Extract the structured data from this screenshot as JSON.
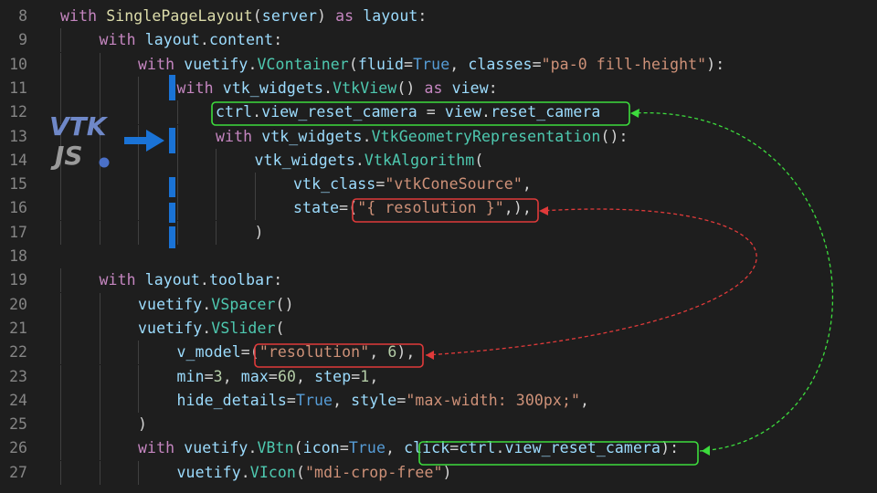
{
  "colors": {
    "background": "#1e1e1e",
    "line_number": "#858585",
    "keyword": "#c586c0",
    "function": "#dcdcaa",
    "class": "#4ec9b0",
    "variable": "#9cdcfe",
    "string": "#ce9178",
    "number": "#b5cea8",
    "builtin": "#569cd6",
    "highlight_green": "#3ddc3d",
    "highlight_red": "#e03a3a",
    "arrow_blue": "#1a73d6"
  },
  "logo": {
    "top_text": "VTK",
    "bottom_text": "JS",
    "icon": "vtkjs-logo-icon"
  },
  "arrow_icon": "right-arrow-icon",
  "lines": [
    {
      "n": "8",
      "indent": 0,
      "tokens": [
        [
          "kw",
          "with"
        ],
        [
          "op",
          " "
        ],
        [
          "fn",
          "SinglePageLayout"
        ],
        [
          "op",
          "("
        ],
        [
          "var",
          "server"
        ],
        [
          "op",
          ") "
        ],
        [
          "kw",
          "as"
        ],
        [
          "op",
          " "
        ],
        [
          "var",
          "layout"
        ],
        [
          "op",
          ":"
        ]
      ]
    },
    {
      "n": "9",
      "indent": 1,
      "tokens": [
        [
          "kw",
          "with"
        ],
        [
          "op",
          " "
        ],
        [
          "var",
          "layout"
        ],
        [
          "op",
          "."
        ],
        [
          "var",
          "content"
        ],
        [
          "op",
          ":"
        ]
      ]
    },
    {
      "n": "10",
      "indent": 2,
      "tokens": [
        [
          "kw",
          "with"
        ],
        [
          "op",
          " "
        ],
        [
          "var",
          "vuetify"
        ],
        [
          "op",
          "."
        ],
        [
          "cls",
          "VContainer"
        ],
        [
          "op",
          "("
        ],
        [
          "var",
          "fluid"
        ],
        [
          "op",
          "="
        ],
        [
          "bi",
          "True"
        ],
        [
          "op",
          ", "
        ],
        [
          "var",
          "classes"
        ],
        [
          "op",
          "="
        ],
        [
          "str",
          "\"pa-0 fill-height\""
        ],
        [
          "op",
          "):"
        ]
      ]
    },
    {
      "n": "11",
      "indent": 3,
      "tokens": [
        [
          "kw",
          "with"
        ],
        [
          "op",
          " "
        ],
        [
          "var",
          "vtk_widgets"
        ],
        [
          "op",
          "."
        ],
        [
          "cls",
          "VtkView"
        ],
        [
          "op",
          "() "
        ],
        [
          "kw",
          "as"
        ],
        [
          "op",
          " "
        ],
        [
          "var",
          "view"
        ],
        [
          "op",
          ":"
        ]
      ]
    },
    {
      "n": "12",
      "indent": 4,
      "tokens": [
        [
          "var",
          "ctrl"
        ],
        [
          "op",
          "."
        ],
        [
          "var",
          "view_reset_camera"
        ],
        [
          "op",
          " = "
        ],
        [
          "var",
          "view"
        ],
        [
          "op",
          "."
        ],
        [
          "var",
          "reset_camera"
        ]
      ]
    },
    {
      "n": "13",
      "indent": 4,
      "tokens": [
        [
          "kw",
          "with"
        ],
        [
          "op",
          " "
        ],
        [
          "var",
          "vtk_widgets"
        ],
        [
          "op",
          "."
        ],
        [
          "cls",
          "VtkGeometryRepresentation"
        ],
        [
          "op",
          "():"
        ]
      ]
    },
    {
      "n": "14",
      "indent": 5,
      "tokens": [
        [
          "var",
          "vtk_widgets"
        ],
        [
          "op",
          "."
        ],
        [
          "cls",
          "VtkAlgorithm"
        ],
        [
          "op",
          "("
        ]
      ]
    },
    {
      "n": "15",
      "indent": 6,
      "tokens": [
        [
          "var",
          "vtk_class"
        ],
        [
          "op",
          "="
        ],
        [
          "str",
          "\"vtkConeSource\""
        ],
        [
          "op",
          ","
        ]
      ]
    },
    {
      "n": "16",
      "indent": 6,
      "tokens": [
        [
          "var",
          "state"
        ],
        [
          "op",
          "=("
        ],
        [
          "str",
          "\"{ resolution }\""
        ],
        [
          "op",
          ",),"
        ]
      ]
    },
    {
      "n": "17",
      "indent": 5,
      "tokens": [
        [
          "op",
          ")"
        ]
      ]
    },
    {
      "n": "18",
      "indent": 0,
      "tokens": []
    },
    {
      "n": "19",
      "indent": 1,
      "tokens": [
        [
          "kw",
          "with"
        ],
        [
          "op",
          " "
        ],
        [
          "var",
          "layout"
        ],
        [
          "op",
          "."
        ],
        [
          "var",
          "toolbar"
        ],
        [
          "op",
          ":"
        ]
      ]
    },
    {
      "n": "20",
      "indent": 2,
      "tokens": [
        [
          "var",
          "vuetify"
        ],
        [
          "op",
          "."
        ],
        [
          "cls",
          "VSpacer"
        ],
        [
          "op",
          "()"
        ]
      ]
    },
    {
      "n": "21",
      "indent": 2,
      "tokens": [
        [
          "var",
          "vuetify"
        ],
        [
          "op",
          "."
        ],
        [
          "cls",
          "VSlider"
        ],
        [
          "op",
          "("
        ]
      ]
    },
    {
      "n": "22",
      "indent": 3,
      "tokens": [
        [
          "var",
          "v_model"
        ],
        [
          "op",
          "=("
        ],
        [
          "str",
          "\"resolution\""
        ],
        [
          "op",
          ", "
        ],
        [
          "num",
          "6"
        ],
        [
          "op",
          "),"
        ]
      ]
    },
    {
      "n": "23",
      "indent": 3,
      "tokens": [
        [
          "var",
          "min"
        ],
        [
          "op",
          "="
        ],
        [
          "num",
          "3"
        ],
        [
          "op",
          ", "
        ],
        [
          "var",
          "max"
        ],
        [
          "op",
          "="
        ],
        [
          "num",
          "60"
        ],
        [
          "op",
          ", "
        ],
        [
          "var",
          "step"
        ],
        [
          "op",
          "="
        ],
        [
          "num",
          "1"
        ],
        [
          "op",
          ","
        ]
      ]
    },
    {
      "n": "24",
      "indent": 3,
      "tokens": [
        [
          "var",
          "hide_details"
        ],
        [
          "op",
          "="
        ],
        [
          "bi",
          "True"
        ],
        [
          "op",
          ", "
        ],
        [
          "var",
          "style"
        ],
        [
          "op",
          "="
        ],
        [
          "str",
          "\"max-width: 300px;\""
        ],
        [
          "op",
          ","
        ]
      ]
    },
    {
      "n": "25",
      "indent": 2,
      "tokens": [
        [
          "op",
          ")"
        ]
      ]
    },
    {
      "n": "26",
      "indent": 2,
      "tokens": [
        [
          "kw",
          "with"
        ],
        [
          "op",
          " "
        ],
        [
          "var",
          "vuetify"
        ],
        [
          "op",
          "."
        ],
        [
          "cls",
          "VBtn"
        ],
        [
          "op",
          "("
        ],
        [
          "var",
          "icon"
        ],
        [
          "op",
          "="
        ],
        [
          "bi",
          "True"
        ],
        [
          "op",
          ", "
        ],
        [
          "var",
          "click"
        ],
        [
          "op",
          "="
        ],
        [
          "var",
          "ctrl"
        ],
        [
          "op",
          "."
        ],
        [
          "var",
          "view_reset_camera"
        ],
        [
          "op",
          "):"
        ]
      ]
    },
    {
      "n": "27",
      "indent": 3,
      "tokens": [
        [
          "var",
          "vuetify"
        ],
        [
          "op",
          "."
        ],
        [
          "cls",
          "VIcon"
        ],
        [
          "op",
          "("
        ],
        [
          "str",
          "\"mdi-crop-free\""
        ],
        [
          "op",
          ")"
        ]
      ]
    }
  ]
}
